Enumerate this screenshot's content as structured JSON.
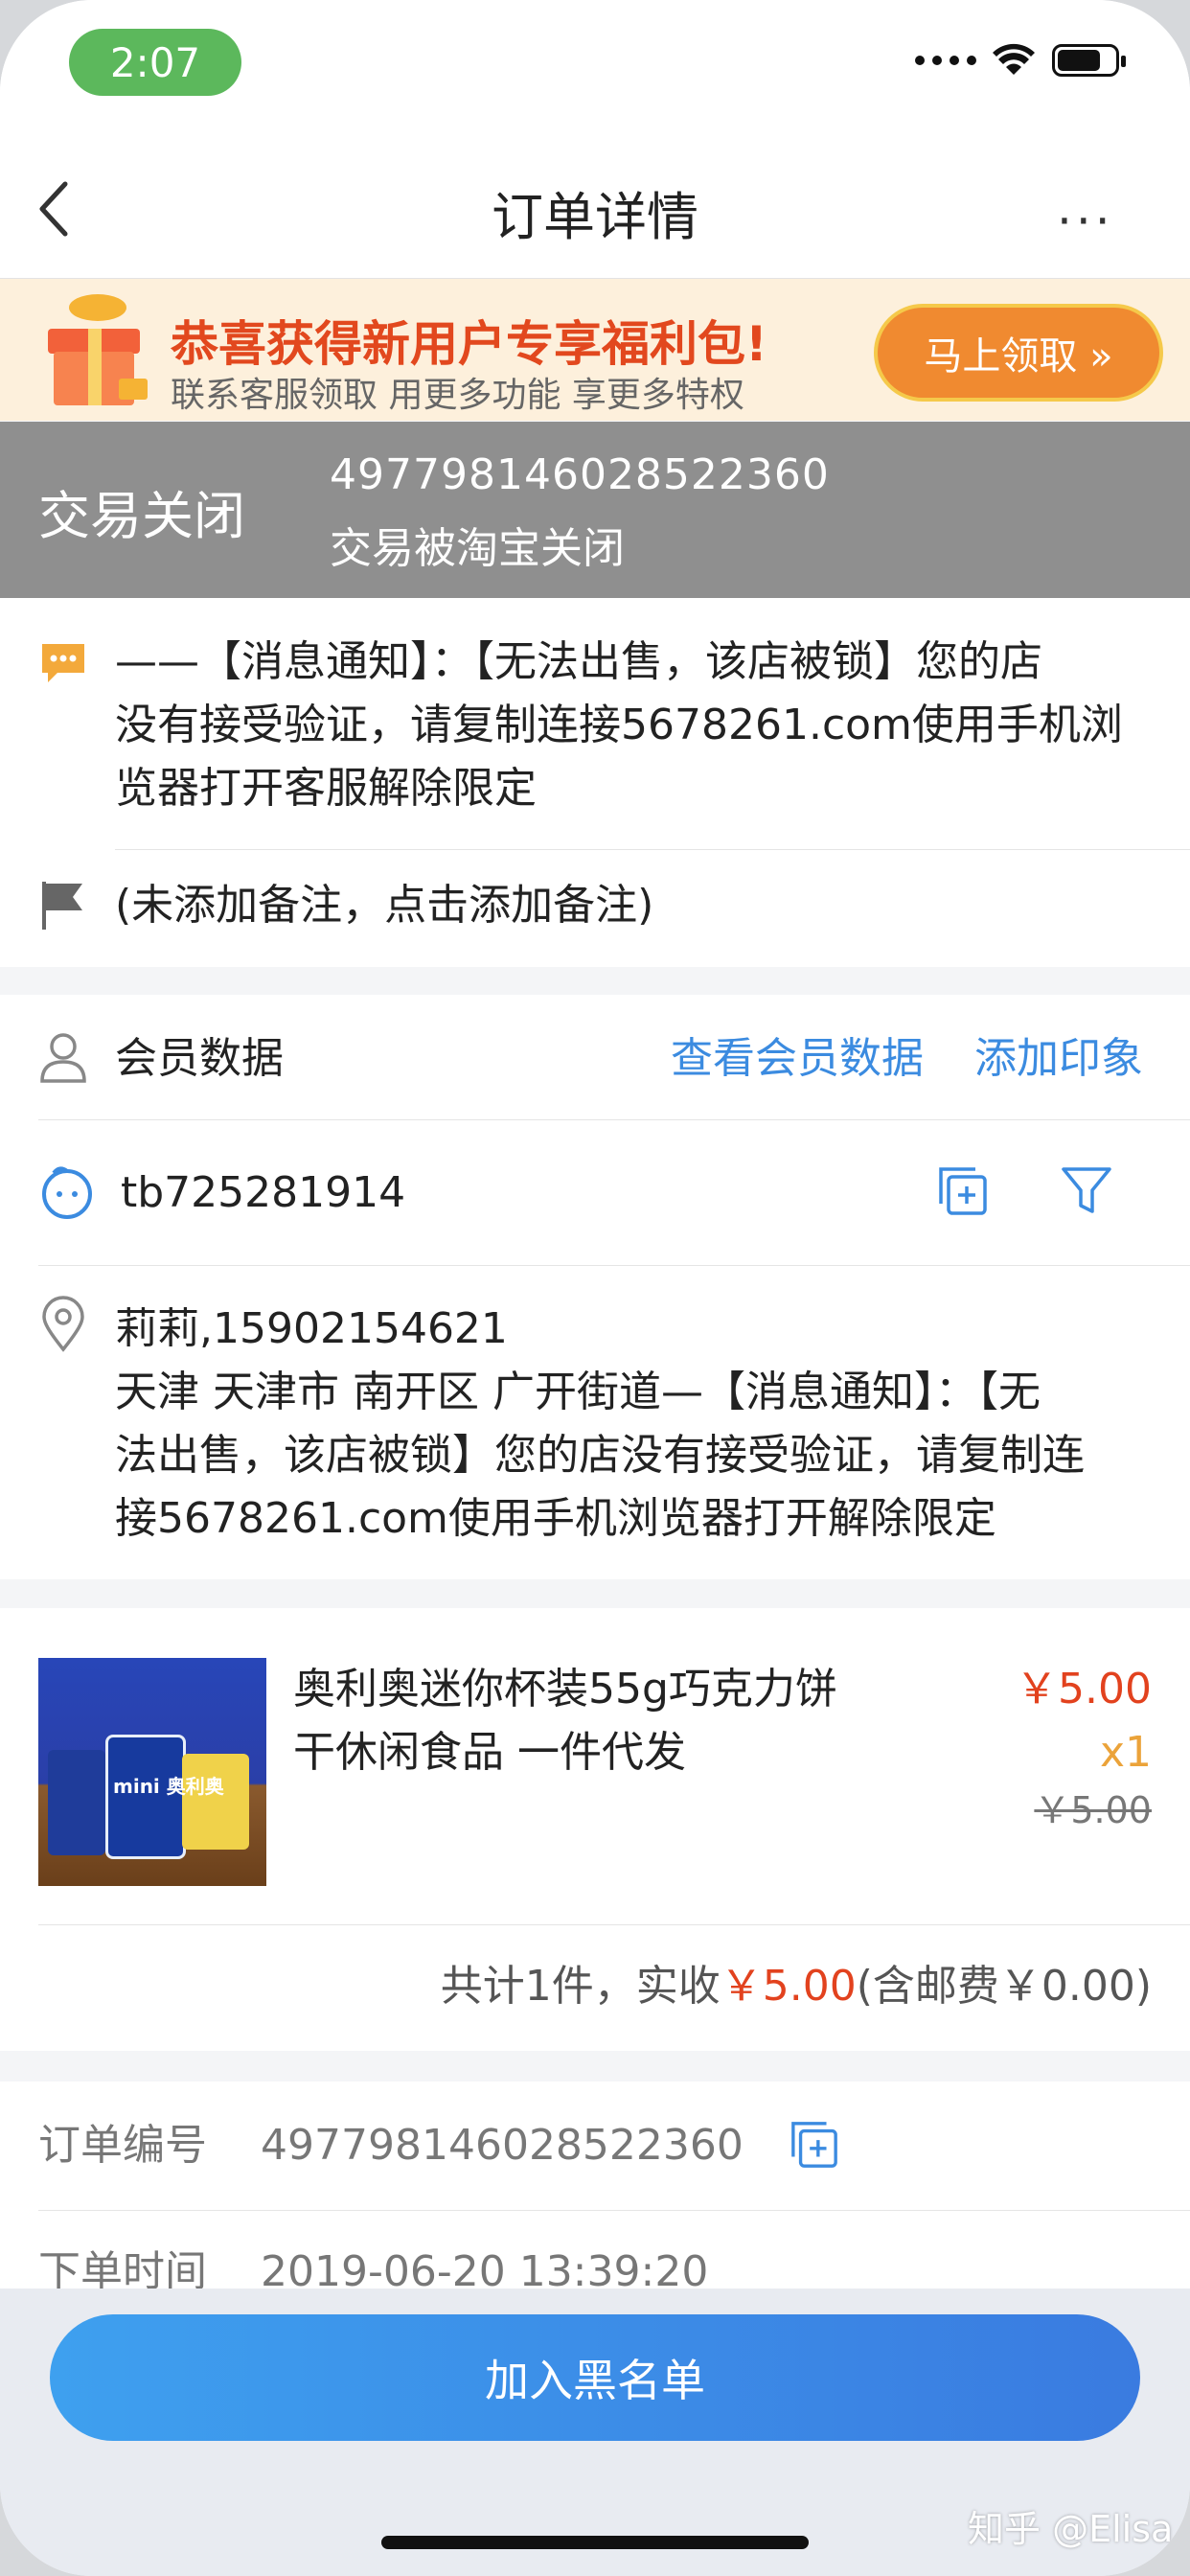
{
  "status_bar": {
    "time": "2:07"
  },
  "nav": {
    "title": "订单详情",
    "more": "···"
  },
  "banner": {
    "headline_emphasis": "恭喜获得",
    "headline_rest": "新用户专享福利包!",
    "subline": "联系客服领取 用更多功能 享更多特权",
    "button": "马上领取 »"
  },
  "order_status": {
    "title": "交易关闭",
    "order_no": "497798146028522360",
    "desc": "交易被淘宝关闭"
  },
  "message": {
    "lines": [
      "——【消息通知】：【无法出售，该店被锁】您的店",
      "没有接受验证，请复制连接5678261.com使用手机浏",
      "览器打开客服解除限定"
    ]
  },
  "remark": {
    "text": "(未添加备注，点击添加备注)"
  },
  "member": {
    "label": "会员数据",
    "link_view": "查看会员数据",
    "link_add": "添加印象"
  },
  "buyer": {
    "id": "tb725281914"
  },
  "address": {
    "name_phone": "莉莉,15902154621",
    "lines": [
      "天津 天津市 南开区 广开街道—【消息通知】：【无",
      "法出售，该店被锁】您的店没有接受验证，请复制连",
      "接5678261.com使用手机浏览器打开解除限定"
    ]
  },
  "product": {
    "title_lines": [
      "奥利奥迷你杯装55g巧克力饼",
      "干休闲食品 一件代发"
    ],
    "price": "￥5.00",
    "qty": "x1",
    "original_price": "￥5.00",
    "image_text": "mini 奥利奥"
  },
  "summary": {
    "prefix": "共计1件，实收",
    "amount": "￥5.00",
    "suffix": "(含邮费￥0.00)"
  },
  "order_info": {
    "no_label": "订单编号",
    "no_value": "497798146028522360",
    "time_label": "下单时间",
    "time_value": "2019-06-20 13:39:20"
  },
  "actions": {
    "blacklist": "加入黑名单"
  },
  "watermark": "知乎 @Elisa",
  "colors": {
    "accent_blue": "#3b8be0",
    "price_red": "#e2421e",
    "status_gray": "#8f8f8f",
    "banner_orange": "#f08a30"
  }
}
